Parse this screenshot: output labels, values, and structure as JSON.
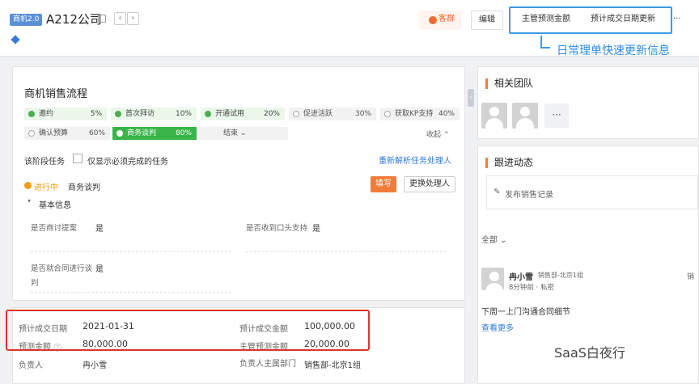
{
  "header": {
    "version_badge": "商机2.0",
    "company_name": "A212公司",
    "prev_label": "‹",
    "next_label": "›",
    "alert_label": "客群",
    "edit_label": "编辑",
    "supervisor_forecast_label": "主管预测金额",
    "expected_close_update_label": "预计成交日期更新",
    "more_label": "···",
    "annotation": "日常理单快速更新信息"
  },
  "colors": {
    "accent": "#3b9be6",
    "stage_done": "#4caf50",
    "stage_active": "#39b54a",
    "orange": "#f37b39",
    "highlight_red": "#e2322d"
  },
  "sales_process": {
    "title": "商机销售流程",
    "stages": [
      {
        "name": "邀约",
        "pct": "5%",
        "status": "done"
      },
      {
        "name": "首次拜访",
        "pct": "10%",
        "status": "done"
      },
      {
        "name": "开通试用",
        "pct": "20%",
        "status": "done"
      },
      {
        "name": "促进活跃",
        "pct": "30%",
        "status": "pending"
      },
      {
        "name": "获取KP支持",
        "pct": "40%",
        "status": "pending"
      },
      {
        "name": "确认预算",
        "pct": "60%",
        "status": "pending"
      },
      {
        "name": "商务谈判",
        "pct": "80%",
        "status": "active"
      },
      {
        "name": "结束 ⌄",
        "pct": "",
        "status": "pending"
      }
    ],
    "collapse_label": "收起 ⌃"
  },
  "tasks": {
    "label": "该阶段任务",
    "only_required_label": "仅显示必须完成的任务",
    "reparse_link": "重新解析任务处理人",
    "in_progress_label": "进行中",
    "current_stage": "商务谈判",
    "fill_button": "填写",
    "change_handler_button": "更换处理人"
  },
  "basic_info": {
    "title": "基本信息",
    "fields": [
      {
        "label": "是否商讨提案",
        "value": "是"
      },
      {
        "label": "是否收到口头支持",
        "value": "是"
      },
      {
        "label": "是否就合同进行谈判",
        "value": "是"
      }
    ]
  },
  "deal_fields": {
    "expected_close_date_label": "预计成交日期",
    "expected_close_date": "2021-01-31",
    "expected_amount_label": "预计成交金额",
    "expected_amount": "100,000.00",
    "forecast_amount_label": "预测金额",
    "forecast_amount": "80,000.00",
    "supervisor_forecast_label": "主管预测金额",
    "supervisor_forecast": "20,000.00",
    "owner_label": "负责人",
    "owner": "冉小雪",
    "owner_dept_label": "负责人主属部门",
    "owner_dept": "销售部-北京1组",
    "help_icon": "?"
  },
  "team": {
    "title": "相关团队",
    "more_label": "···"
  },
  "followup": {
    "title": "跟进动态",
    "post_placeholder": "发布销售记录",
    "filter_label": "全部 ⌄",
    "entry": {
      "author": "冉小雪",
      "dept": "销售部-北京1组",
      "time": "8分钟前 · 私密",
      "content": "下周一上门沟通合同细节",
      "more_link": "查看更多",
      "truncated": "销"
    }
  },
  "watermark": "SaaS白夜行"
}
